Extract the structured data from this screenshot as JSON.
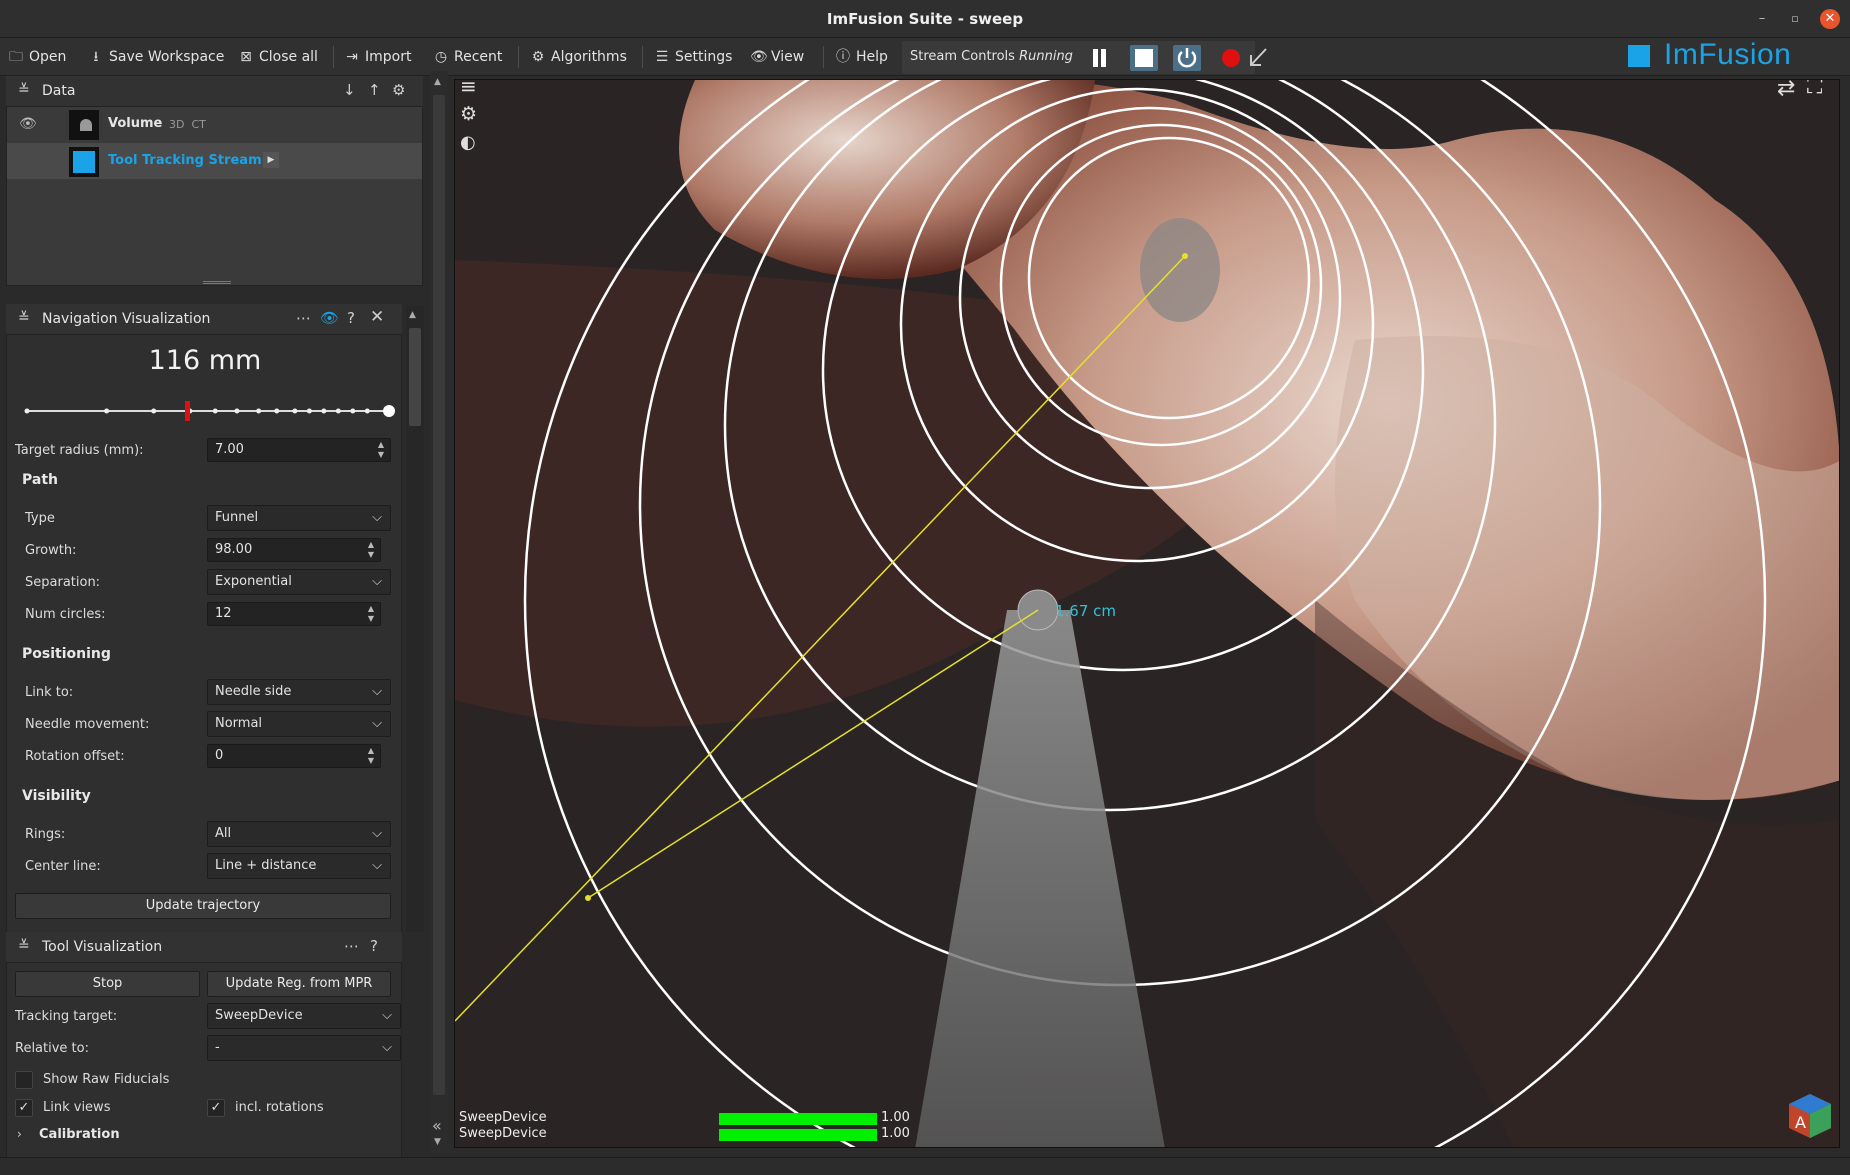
{
  "window": {
    "title": "ImFusion Suite - sweep"
  },
  "toolbar": {
    "open": "Open",
    "save_workspace": "Save Workspace",
    "close_all": "Close all",
    "import": "Import",
    "recent": "Recent",
    "algorithms": "Algorithms",
    "settings": "Settings",
    "view": "View",
    "help": "Help",
    "stream_controls": "Stream Controls",
    "stream_status": "Running",
    "logo": "ImFusion"
  },
  "data_panel": {
    "title": "Data",
    "items": [
      {
        "name": "Volume",
        "tags": "3D  CT"
      },
      {
        "name": "Tool Tracking Stream"
      }
    ]
  },
  "nav_panel": {
    "title": "Navigation Visualization",
    "distance": "116 mm",
    "slider_fraction": 0.5,
    "target_radius_label": "Target radius (mm):",
    "target_radius": "7.00",
    "path": {
      "heading": "Path",
      "type_label": "Type",
      "type": "Funnel",
      "growth_label": "Growth:",
      "growth": "98.00",
      "separation_label": "Separation:",
      "separation": "Exponential",
      "num_circles_label": "Num circles:",
      "num_circles": "12"
    },
    "positioning": {
      "heading": "Positioning",
      "link_to_label": "Link to:",
      "link_to": "Needle side",
      "needle_movement_label": "Needle movement:",
      "needle_movement": "Normal",
      "rotation_offset_label": "Rotation offset:",
      "rotation_offset": "0"
    },
    "visibility": {
      "heading": "Visibility",
      "rings_label": "Rings:",
      "rings": "All",
      "center_line_label": "Center line:",
      "center_line": "Line + distance"
    },
    "update_trajectory": "Update trajectory"
  },
  "tool_panel": {
    "title": "Tool Visualization",
    "stop": "Stop",
    "update_reg": "Update Reg. from MPR",
    "tracking_target_label": "Tracking target:",
    "tracking_target": "SweepDevice",
    "relative_to_label": "Relative to:",
    "relative_to": "-",
    "show_raw_fiducials": "Show Raw Fiducials",
    "link_views": "Link views",
    "incl_rotations": "incl. rotations",
    "calibration": "Calibration"
  },
  "viewport": {
    "distance_label": "1.67 cm",
    "tracking": [
      {
        "name": "SweepDevice",
        "quality": "1.00",
        "fraction": 1.0
      },
      {
        "name": "SweepDevice",
        "quality": "1.00",
        "fraction": 1.0
      }
    ]
  },
  "colors": {
    "accent": "#1aa3e6",
    "tracking_bar": "#00f000",
    "record": "#e01010",
    "guide_line": "#e6e02a"
  }
}
